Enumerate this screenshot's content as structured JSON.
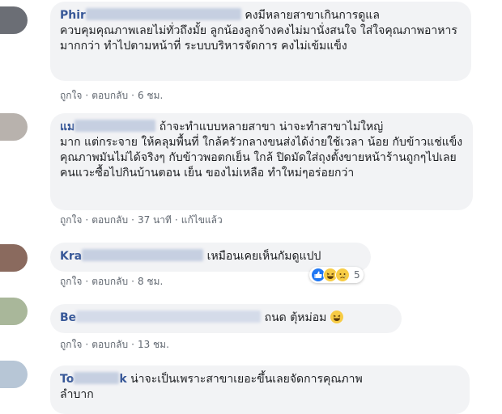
{
  "comments": [
    {
      "author_visible": "Phir",
      "text_line1": "คงมีหลายสาขาเกินการดูแล",
      "text_rest": "ควบคุมคุณภาพเลยไม่ทั่วถึงมั้ย ลูกน้องลูกจ้างคงไม่มานั่งสนใจ ใส่ใจคุณภาพอาหารมากกว่า ทำไปตามหน้าที่ ระบบบริหารจัดการ คงไม่เข้มแข็ง",
      "actions": {
        "like": "ถูกใจ",
        "reply": "ตอบกลับ",
        "time": "6 ชม."
      },
      "avatar_color": "#6b6e75"
    },
    {
      "author_visible": "แม",
      "text_line1": "ถ้าจะทำแบบหลายสาขา น่าจะทำสาขาไม่ใหญ่",
      "text_rest": "มาก แต่กระจาย ให้คลุมพื้นที่ ใกล้ครัวกลางขนส่งได้ง่ายใช้เวลา น้อย กับข้าวแช่แข็งคุณภาพมันไม่ได้จริงๆ กับข้าวพอตกเย็น ใกล้ ปิดมัดใส่ถุงตั้งขายหน้าร้านถูกๆไปเลย คนแวะซื้อไปกินบ้านตอน เย็น ของไม่เหลือ ทำใหม่ๆอร่อยกว่า",
      "actions": {
        "like": "ถูกใจ",
        "reply": "ตอบกลับ",
        "time": "37 นาที",
        "edited": "แก้ไขแล้ว"
      },
      "avatar_color": "#b8b2ad"
    },
    {
      "author_visible": "Kra",
      "text_line1": "เหมือนเคยเห็นกัมดูแปป",
      "actions": {
        "like": "ถูกใจ",
        "reply": "ตอบกลับ",
        "time": "8 ชม."
      },
      "reaction_count": "5",
      "avatar_color": "#8a6a5e"
    },
    {
      "author_visible": "Be",
      "text_line1": "ถนด ตุ้หม่อม",
      "actions": {
        "like": "ถูกใจ",
        "reply": "ตอบกลับ",
        "time": "13 ชม."
      },
      "avatar_color": "#a9b79a"
    },
    {
      "author_visible": "To",
      "author_tail": "k",
      "text_line1": "น่าจะเป็นเพราะสาขาเยอะขึ้นเลยจัดการคุณภาพ",
      "text_rest": "ลำบาก",
      "avatar_color": "#b7c6d6"
    }
  ]
}
